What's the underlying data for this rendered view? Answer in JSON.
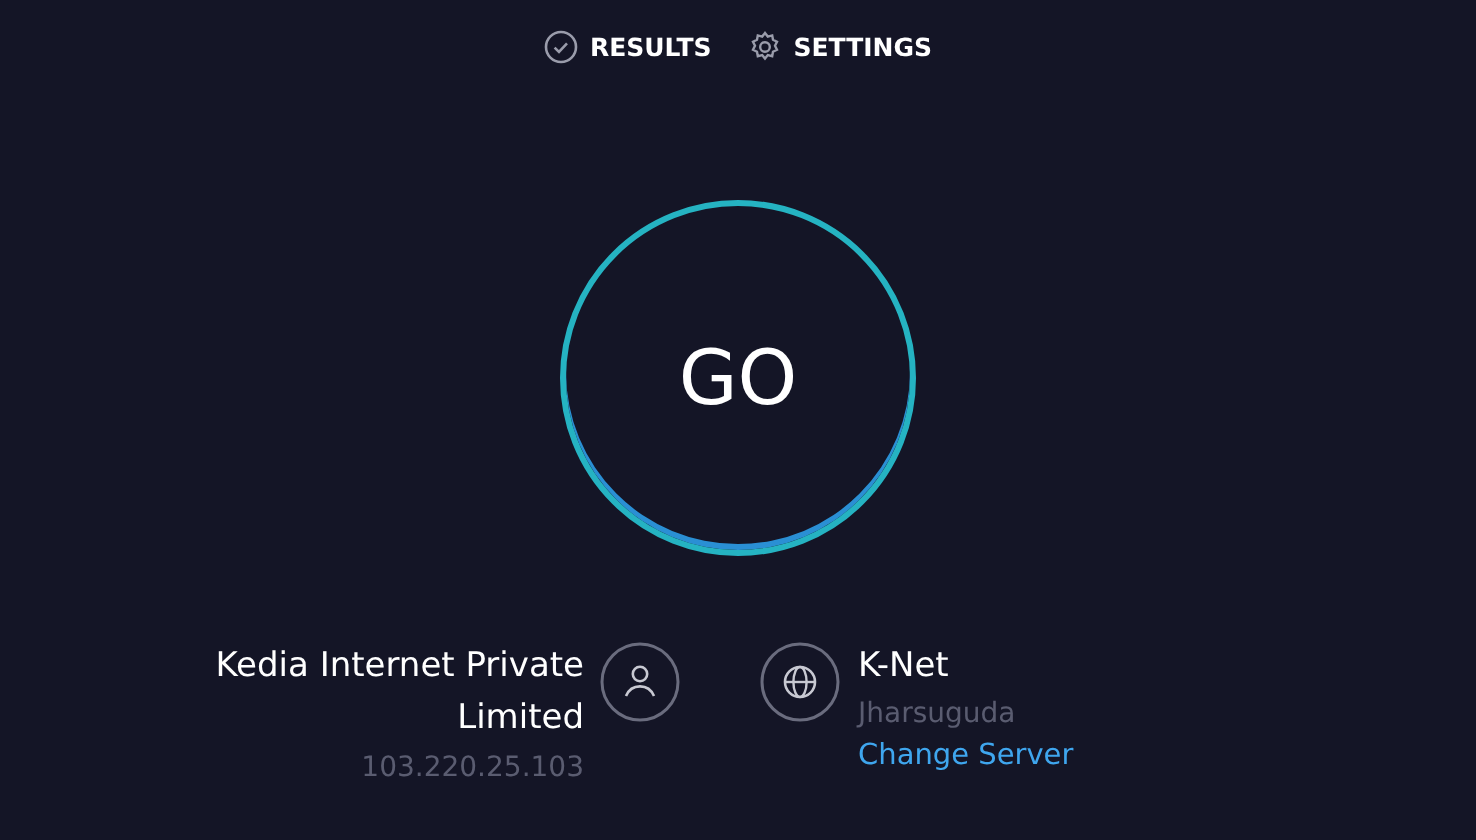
{
  "nav": [
    {
      "label": "RESULTS",
      "kind": "results"
    },
    {
      "label": "SETTINGS",
      "kind": "settings"
    }
  ],
  "go_button": {
    "label": "GO"
  },
  "isp": {
    "name": "Kedia Internet Private Limited",
    "ip": "103.220.25.103"
  },
  "server": {
    "name": "K-Net",
    "location": "Jharsuguda",
    "change_link": "Change Server"
  }
}
